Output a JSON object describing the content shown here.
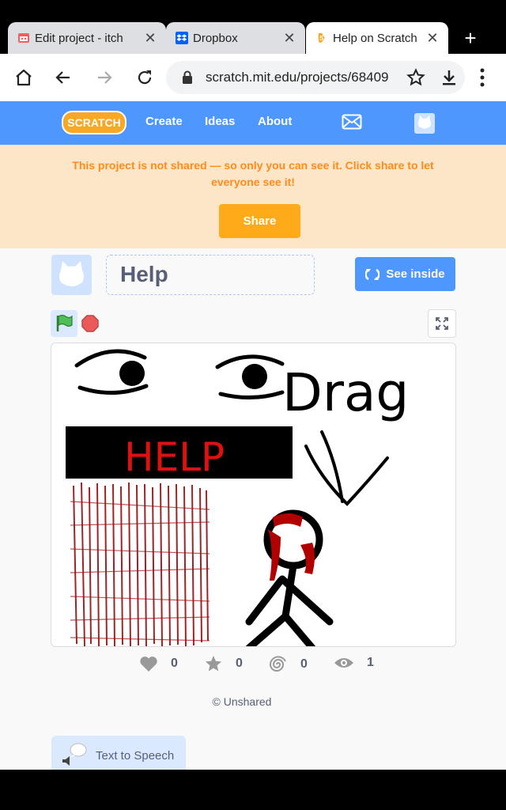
{
  "tabs": [
    {
      "title": "Edit project - itch",
      "favicon": "itch-icon",
      "active": false
    },
    {
      "title": "Dropbox",
      "favicon": "dropbox-icon",
      "active": false
    },
    {
      "title": "Help on Scratch",
      "favicon": "scratch-favicon",
      "active": true
    }
  ],
  "toolbar": {
    "url": "scratch.mit.edu/projects/68409"
  },
  "scratch_nav": {
    "logo_text": "SCRATCH",
    "create": "Create",
    "ideas": "Ideas",
    "about": "About"
  },
  "banner": {
    "message": "This project is not shared — so only you can see it. Click share to let everyone see it!",
    "share_label": "Share"
  },
  "project": {
    "title": "Help",
    "see_inside_label": "See inside"
  },
  "stage_content": {
    "word_drag": "Drag",
    "word_help": "HELP"
  },
  "stats": {
    "loves": "0",
    "favorites": "0",
    "remixes": "0",
    "views": "1"
  },
  "share_status": "Unshared",
  "extension": {
    "label": "Text to Speech"
  },
  "colors": {
    "scratch_blue": "#4d97ff",
    "banner_bg": "#fce6c7",
    "banner_text": "#ff8c1a",
    "share_orange": "#ffab19",
    "blood_red": "#8b0000",
    "help_red": "#e01010"
  }
}
